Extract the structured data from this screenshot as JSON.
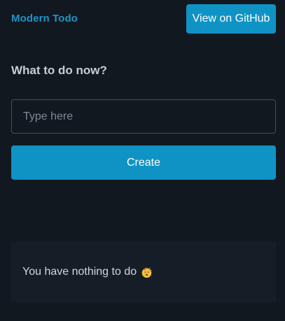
{
  "header": {
    "brand": "Modern Todo",
    "github_button": "View on GitHub"
  },
  "form": {
    "heading": "What to do now?",
    "input_placeholder": "Type here",
    "input_value": "",
    "create_button": "Create"
  },
  "empty_state": {
    "message": "You have nothing to do",
    "icon": "party-popper-icon"
  },
  "colors": {
    "background": "#11181f",
    "accent": "#0f93c4",
    "brand": "#1f93c6",
    "card": "#151e26",
    "input_border": "#46505a"
  }
}
